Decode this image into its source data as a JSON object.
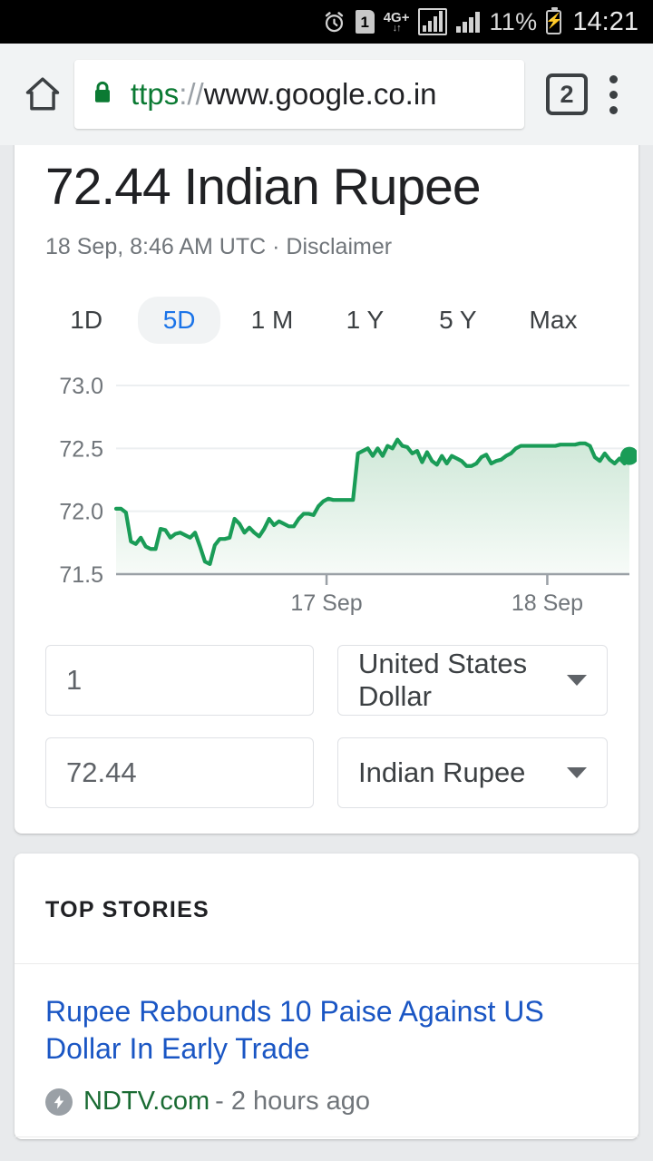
{
  "status_bar": {
    "alarm_icon": "alarm-clock-icon",
    "sim_label": "1",
    "network_label": "4G+",
    "battery_percent": "11%",
    "battery_icon": "battery-charging-icon",
    "time": "14:21"
  },
  "browser": {
    "home_icon": "home-icon",
    "lock_icon": "lock-icon",
    "url_scheme": "ttps",
    "url_separator": "://",
    "url_host": "www.google.co.in",
    "tab_count": "2",
    "menu_icon": "overflow-menu-icon"
  },
  "converter": {
    "title": "72.44 Indian Rupee",
    "subtitle": "18 Sep, 8:46 AM UTC · Disclaimer",
    "range_tabs": [
      {
        "label": "1D",
        "selected": false
      },
      {
        "label": "5D",
        "selected": true
      },
      {
        "label": "1 M",
        "selected": false
      },
      {
        "label": "1 Y",
        "selected": false
      },
      {
        "label": "5 Y",
        "selected": false
      },
      {
        "label": "Max",
        "selected": false
      }
    ],
    "from_amount": "1",
    "from_currency": "United States Dollar",
    "to_amount": "72.44",
    "to_currency": "Indian Rupee",
    "accent_green": "#1a9c57",
    "accent_blue": "#1a73e8"
  },
  "top_stories": {
    "header": "TOP STORIES",
    "items": [
      {
        "title": "Rupee Rebounds 10 Paise Against US Dollar In Early Trade",
        "source": "NDTV.com",
        "time": "- 2 hours ago",
        "amp_icon": "amp-lightning-icon"
      }
    ]
  },
  "chart_data": {
    "type": "area",
    "title": "USD to INR exchange rate",
    "xlabel": "",
    "ylabel": "",
    "ylim": [
      71.5,
      73.0
    ],
    "yticks": [
      "71.5",
      "72.0",
      "72.5",
      "73.0"
    ],
    "ytick_values": [
      71.5,
      72.0,
      72.5,
      73.0
    ],
    "xticks": [
      "17 Sep",
      "18 Sep"
    ],
    "xtick_positions": [
      0.41,
      0.84
    ],
    "grid": true,
    "legend": "none",
    "line_color": "#1a9c57",
    "fill_color": "#d8ece0",
    "last_point_value": 72.44,
    "last_point_marker": true,
    "values": [
      72.02,
      72.02,
      71.99,
      71.76,
      71.74,
      71.79,
      71.72,
      71.7,
      71.7,
      71.86,
      71.85,
      71.79,
      71.82,
      71.83,
      71.81,
      71.79,
      71.83,
      71.72,
      71.6,
      71.58,
      71.73,
      71.78,
      71.78,
      71.79,
      71.94,
      71.9,
      71.83,
      71.87,
      71.83,
      71.8,
      71.86,
      71.94,
      71.89,
      71.92,
      71.9,
      71.88,
      71.88,
      71.94,
      71.98,
      71.98,
      71.97,
      72.04,
      72.08,
      72.1,
      72.09,
      72.09,
      72.09,
      72.09,
      72.09,
      72.46,
      72.48,
      72.5,
      72.44,
      72.5,
      72.44,
      72.52,
      72.5,
      72.57,
      72.52,
      72.51,
      72.46,
      72.48,
      72.39,
      72.47,
      72.4,
      72.37,
      72.44,
      72.38,
      72.44,
      72.42,
      72.4,
      72.36,
      72.36,
      72.38,
      72.43,
      72.45,
      72.38,
      72.4,
      72.41,
      72.44,
      72.46,
      72.5,
      72.52,
      72.52,
      72.52,
      72.52,
      72.52,
      72.52,
      72.52,
      72.52,
      72.53,
      72.53,
      72.53,
      72.53,
      72.54,
      72.54,
      72.52,
      72.43,
      72.4,
      72.46,
      72.41,
      72.38,
      72.42,
      72.38,
      72.44
    ]
  }
}
